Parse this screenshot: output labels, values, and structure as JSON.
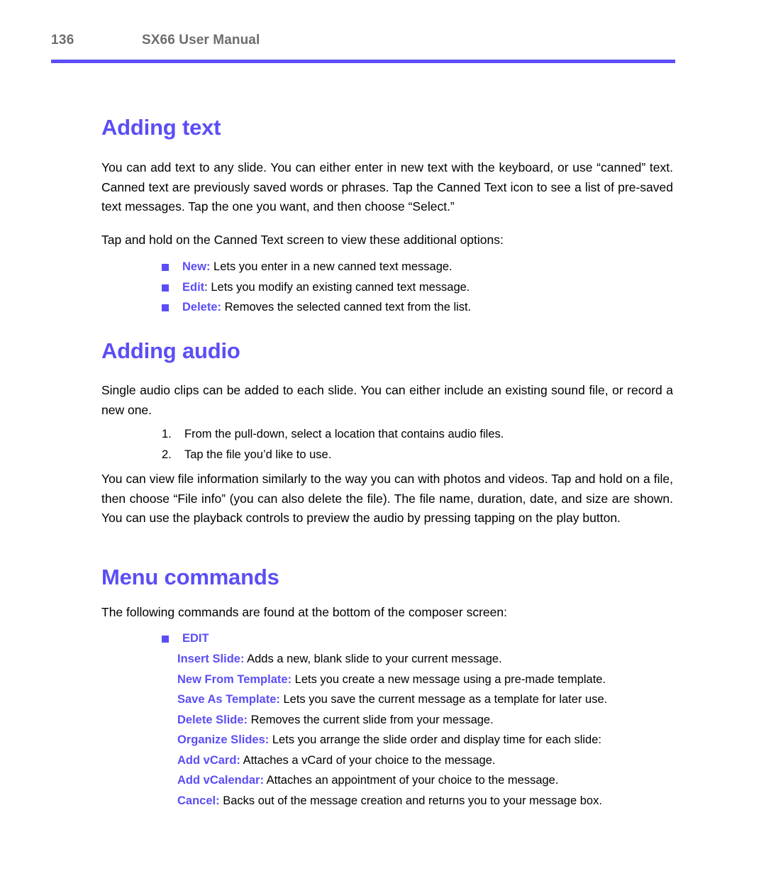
{
  "header": {
    "page_number": "136",
    "title": "SX66 User Manual",
    "rule_color": "#5b4ef5"
  },
  "theme": {
    "accent": "#5b4ef5",
    "header_gray": "#6d6d6d",
    "body_black": "#000000"
  },
  "sections": {
    "adding_text": {
      "heading": "Adding text",
      "paragraph": "You can add text to any slide.  You can either enter in new text with the keyboard, or use “canned” text.  Canned text are previously saved words or phrases. Tap the Canned Text icon to see a list of pre-saved text messages. Tap the one you want, and then choose “Select.”",
      "intro": "Tap and hold on the Canned Text screen to view these additional options:",
      "options": [
        {
          "term": "New",
          "colon_colored": true,
          "description": " Lets you enter in a new canned text message."
        },
        {
          "term": "Edit",
          "colon_colored": false,
          "description": " Lets you modify an existing canned text message."
        },
        {
          "term": "Delete",
          "colon_colored": true,
          "description": " Removes the selected canned text from the list."
        }
      ]
    },
    "adding_audio": {
      "heading": "Adding audio",
      "paragraph": "Single audio clips can be added to each slide.  You can either include an existing sound file, or record a new one.",
      "steps": [
        {
          "number": "1.",
          "text": "From the pull-down, select a location that contains audio files."
        },
        {
          "number": "2.",
          "text": "Tap the file you’d like to use."
        }
      ],
      "paragraph2": "You can view file information similarly to the way you can with photos and videos.  Tap and hold on a file, then choose “File info” (you can also delete the file). The file name, duration, date, and size are shown. You can use the playback controls to preview the audio by pressing tapping on the play button."
    },
    "menu_commands": {
      "heading": "Menu commands",
      "intro": "The following commands are found at the bottom of the composer screen:",
      "group_label": "EDIT",
      "commands": [
        {
          "term": "Insert Slide:",
          "description": " Adds a new, blank slide to your current message."
        },
        {
          "term": "New From Template:",
          "description": " Lets you create a new message using a pre-made template."
        },
        {
          "term": "Save As Template:",
          "description": " Lets you save the current message as a template for later use."
        },
        {
          "term": "Delete Slide:",
          "description": " Removes the current slide from your message."
        },
        {
          "term": "Organize Slides:",
          "description": " Lets you arrange the slide order and display time for each slide:"
        },
        {
          "term": "Add vCard:",
          "description": " Attaches a vCard of your choice to the message."
        },
        {
          "term": "Add vCalendar:",
          "description": " Attaches an appointment of your choice to the message."
        },
        {
          "term": "Cancel:",
          "description": " Backs out of the message creation and returns you to your message box."
        }
      ]
    }
  }
}
